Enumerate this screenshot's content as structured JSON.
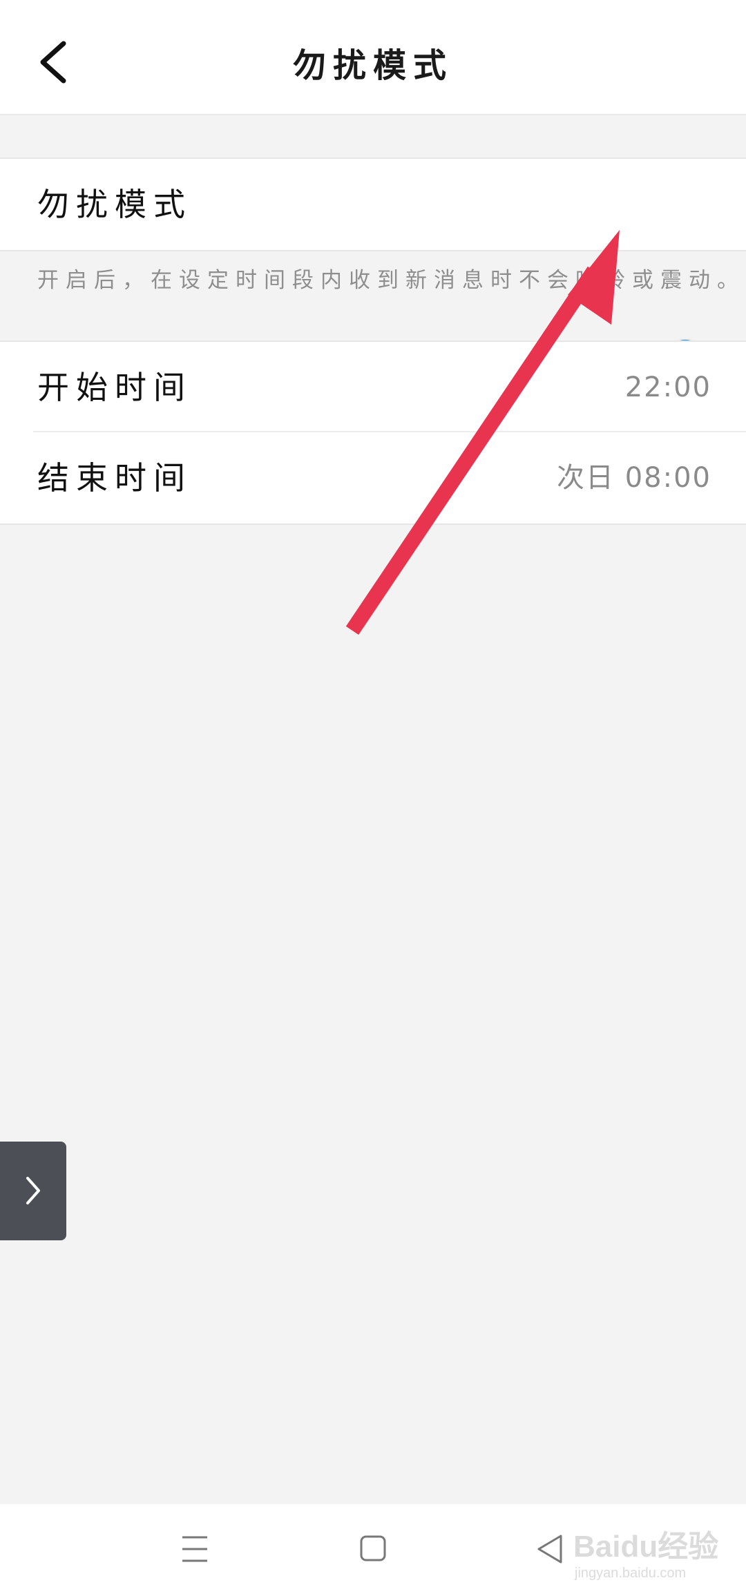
{
  "header": {
    "title": "勿扰模式",
    "back_icon": "chevron-left-icon"
  },
  "dnd": {
    "label": "勿扰模式",
    "enabled": true,
    "hint": "开启后，在设定时间段内收到新消息时不会响铃或震动。"
  },
  "schedule": {
    "start_label": "开始时间",
    "start_value": "22:00",
    "end_label": "结束时间",
    "end_value": "次日 08:00"
  },
  "side_tab": {
    "icon": "chevron-right-icon"
  },
  "navbar": {
    "menu_icon": "menu-icon",
    "home_icon": "home-square-icon",
    "back_icon": "back-triangle-icon"
  },
  "watermark": {
    "text": "Baidu经验",
    "sub": "jingyan.baidu.com"
  },
  "colors": {
    "toggle_on": "#0a84ee",
    "toggle_track": "#7dc3f5",
    "annotation_arrow": "#e8344f"
  }
}
